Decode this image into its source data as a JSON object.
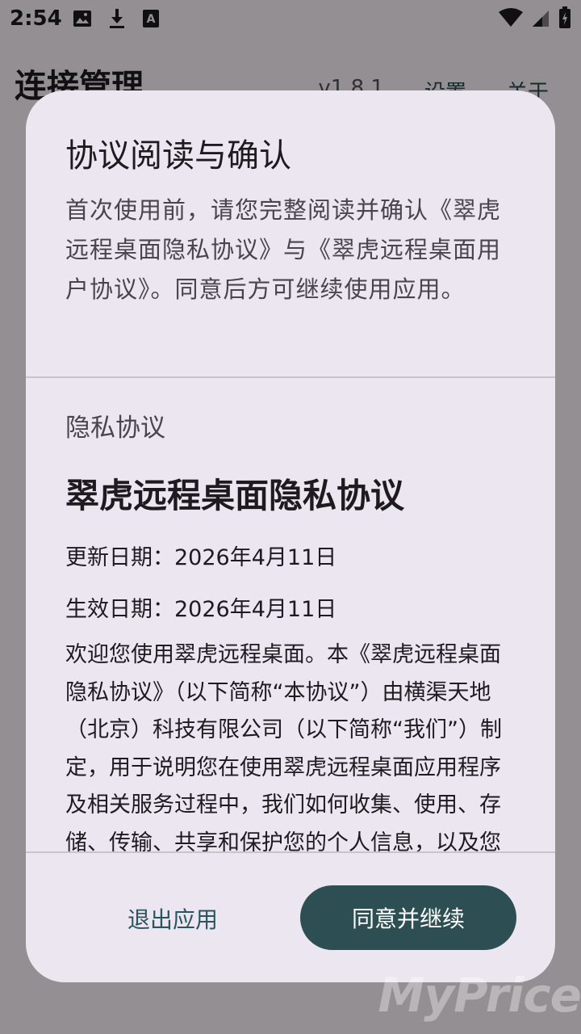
{
  "status_bar": {
    "time": "2:54"
  },
  "app_bar": {
    "title": "连接管理",
    "version": "v1.8.1",
    "settings": "设置",
    "about": "关于"
  },
  "dialog": {
    "title": "协议阅读与确认",
    "intro": "首次使用前，请您完整阅读并确认《翠虎远程桌面隐私协议》与《翠虎远程桌面用户协议》。同意后方可继续使用应用。",
    "section_label": "隐私协议",
    "doc_heading": "翠虎远程桌面隐私协议",
    "updated_date": "更新日期：2026年4月11日",
    "effective_date": "生效日期：2026年4月11日",
    "body": "欢迎您使用翠虎远程桌面。本《翠虎远程桌面隐私协议》（以下简称“本协议”）由横渠天地（北京）科技有限公司（以下简称“我们”）制定，用于说明您在使用翠虎远程桌面应用程序及相关服务过程中，我们如何收集、使用、存储、传输、共享和保护您的个人信息，以及您",
    "exit_button": "退出应用",
    "agree_button": "同意并继续"
  },
  "watermark": "MyPrice",
  "colors": {
    "primary": "#2d4e53",
    "dialog_bg": "#ece6f0",
    "scrim": "rgba(0,0,0,0.42)"
  }
}
